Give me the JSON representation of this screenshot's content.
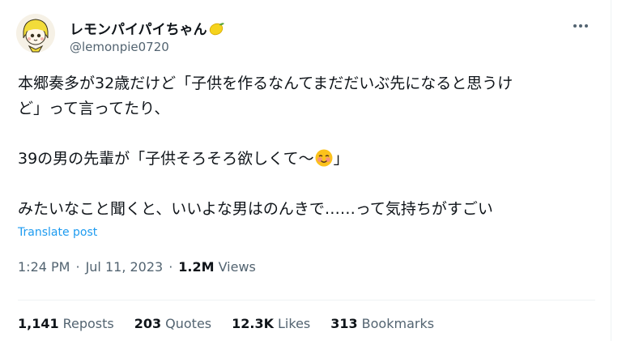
{
  "author": {
    "display_name": "レモンパイパイちゃん",
    "name_emoji": "lemon-icon",
    "handle": "@lemonpie0720",
    "avatar": "cartoon-girl-avatar"
  },
  "tweet": {
    "lines": [
      "本郷奏多が32歳だけど「子供を作るなんてまだだいぶ先になると思うけ",
      "ど」って言ってたり、",
      "",
      "39の男の先輩が「子供そろそろ欲しくて～",
      "」",
      "",
      "みたいなこと聞くと、いいよな男はのんきで……って気持ちがすごい"
    ],
    "emoji": "smiling-face-with-blush-icon"
  },
  "translate_label": "Translate post",
  "meta": {
    "time": "1:24 PM",
    "separator": "·",
    "date": "Jul 11, 2023",
    "views_count": "1.2M",
    "views_label": "Views"
  },
  "stats": {
    "reposts_count": "1,141",
    "reposts_label": "Reposts",
    "quotes_count": "203",
    "quotes_label": "Quotes",
    "likes_count": "12.3K",
    "likes_label": "Likes",
    "bookmarks_count": "313",
    "bookmarks_label": "Bookmarks"
  },
  "colors": {
    "text_primary": "#0f1419",
    "text_secondary": "#536471",
    "link": "#1d9bf0",
    "divider": "#eff3f4"
  }
}
